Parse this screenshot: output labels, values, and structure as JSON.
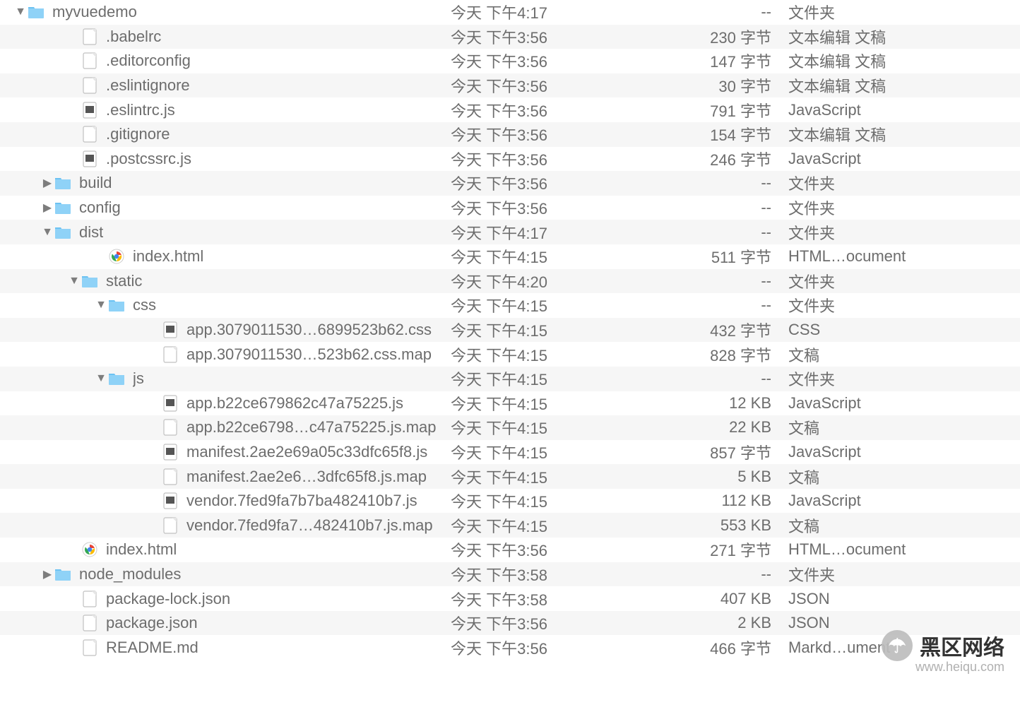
{
  "watermark": {
    "text": "黑区网络",
    "sub": "www.heiqu.com",
    "glyph": "☂"
  },
  "icons": {
    "folder": "folder",
    "file": "file",
    "jsfile": "jsfile",
    "chrome": "chrome"
  },
  "rows": [
    {
      "indent": 0,
      "arrow": "down",
      "icon": "folder",
      "name": "myvuedemo",
      "date": "今天 下午4:17",
      "size": "--",
      "kind": "文件夹"
    },
    {
      "indent": 2,
      "arrow": "",
      "icon": "file",
      "name": ".babelrc",
      "date": "今天 下午3:56",
      "size": "230 字节",
      "kind": "文本编辑 文稿"
    },
    {
      "indent": 2,
      "arrow": "",
      "icon": "file",
      "name": ".editorconfig",
      "date": "今天 下午3:56",
      "size": "147 字节",
      "kind": "文本编辑 文稿"
    },
    {
      "indent": 2,
      "arrow": "",
      "icon": "file",
      "name": ".eslintignore",
      "date": "今天 下午3:56",
      "size": "30 字节",
      "kind": "文本编辑 文稿"
    },
    {
      "indent": 2,
      "arrow": "",
      "icon": "jsfile",
      "name": ".eslintrc.js",
      "date": "今天 下午3:56",
      "size": "791 字节",
      "kind": "JavaScript"
    },
    {
      "indent": 2,
      "arrow": "",
      "icon": "file",
      "name": ".gitignore",
      "date": "今天 下午3:56",
      "size": "154 字节",
      "kind": "文本编辑 文稿"
    },
    {
      "indent": 2,
      "arrow": "",
      "icon": "jsfile",
      "name": ".postcssrc.js",
      "date": "今天 下午3:56",
      "size": "246 字节",
      "kind": "JavaScript"
    },
    {
      "indent": 1,
      "arrow": "right",
      "icon": "folder",
      "name": "build",
      "date": "今天 下午3:56",
      "size": "--",
      "kind": "文件夹"
    },
    {
      "indent": 1,
      "arrow": "right",
      "icon": "folder",
      "name": "config",
      "date": "今天 下午3:56",
      "size": "--",
      "kind": "文件夹"
    },
    {
      "indent": 1,
      "arrow": "down",
      "icon": "folder",
      "name": "dist",
      "date": "今天 下午4:17",
      "size": "--",
      "kind": "文件夹"
    },
    {
      "indent": 3,
      "arrow": "",
      "icon": "chrome",
      "name": "index.html",
      "date": "今天 下午4:15",
      "size": "511 字节",
      "kind": "HTML…ocument"
    },
    {
      "indent": 2,
      "arrow": "down",
      "icon": "folder",
      "name": "static",
      "date": "今天 下午4:20",
      "size": "--",
      "kind": "文件夹"
    },
    {
      "indent": 3,
      "arrow": "down",
      "icon": "folder",
      "name": "css",
      "date": "今天 下午4:15",
      "size": "--",
      "kind": "文件夹"
    },
    {
      "indent": 5,
      "arrow": "",
      "icon": "jsfile",
      "name": "app.3079011530…6899523b62.css",
      "date": "今天 下午4:15",
      "size": "432 字节",
      "kind": "CSS"
    },
    {
      "indent": 5,
      "arrow": "",
      "icon": "file",
      "name": "app.3079011530…523b62.css.map",
      "date": "今天 下午4:15",
      "size": "828 字节",
      "kind": "文稿"
    },
    {
      "indent": 3,
      "arrow": "down",
      "icon": "folder",
      "name": "js",
      "date": "今天 下午4:15",
      "size": "--",
      "kind": "文件夹"
    },
    {
      "indent": 5,
      "arrow": "",
      "icon": "jsfile",
      "name": "app.b22ce679862c47a75225.js",
      "date": "今天 下午4:15",
      "size": "12 KB",
      "kind": "JavaScript"
    },
    {
      "indent": 5,
      "arrow": "",
      "icon": "file",
      "name": "app.b22ce6798…c47a75225.js.map",
      "date": "今天 下午4:15",
      "size": "22 KB",
      "kind": "文稿"
    },
    {
      "indent": 5,
      "arrow": "",
      "icon": "jsfile",
      "name": "manifest.2ae2e69a05c33dfc65f8.js",
      "date": "今天 下午4:15",
      "size": "857 字节",
      "kind": "JavaScript"
    },
    {
      "indent": 5,
      "arrow": "",
      "icon": "file",
      "name": "manifest.2ae2e6…3dfc65f8.js.map",
      "date": "今天 下午4:15",
      "size": "5 KB",
      "kind": "文稿"
    },
    {
      "indent": 5,
      "arrow": "",
      "icon": "jsfile",
      "name": "vendor.7fed9fa7b7ba482410b7.js",
      "date": "今天 下午4:15",
      "size": "112 KB",
      "kind": "JavaScript"
    },
    {
      "indent": 5,
      "arrow": "",
      "icon": "file",
      "name": "vendor.7fed9fa7…482410b7.js.map",
      "date": "今天 下午4:15",
      "size": "553 KB",
      "kind": "文稿"
    },
    {
      "indent": 2,
      "arrow": "",
      "icon": "chrome",
      "name": "index.html",
      "date": "今天 下午3:56",
      "size": "271 字节",
      "kind": "HTML…ocument"
    },
    {
      "indent": 1,
      "arrow": "right",
      "icon": "folder",
      "name": "node_modules",
      "date": "今天 下午3:58",
      "size": "--",
      "kind": "文件夹"
    },
    {
      "indent": 2,
      "arrow": "",
      "icon": "file",
      "name": "package-lock.json",
      "date": "今天 下午3:58",
      "size": "407 KB",
      "kind": "JSON"
    },
    {
      "indent": 2,
      "arrow": "",
      "icon": "file",
      "name": "package.json",
      "date": "今天 下午3:56",
      "size": "2 KB",
      "kind": "JSON"
    },
    {
      "indent": 2,
      "arrow": "",
      "icon": "file",
      "name": "README.md",
      "date": "今天 下午3:56",
      "size": "466 字节",
      "kind": "Markd…ument"
    }
  ]
}
